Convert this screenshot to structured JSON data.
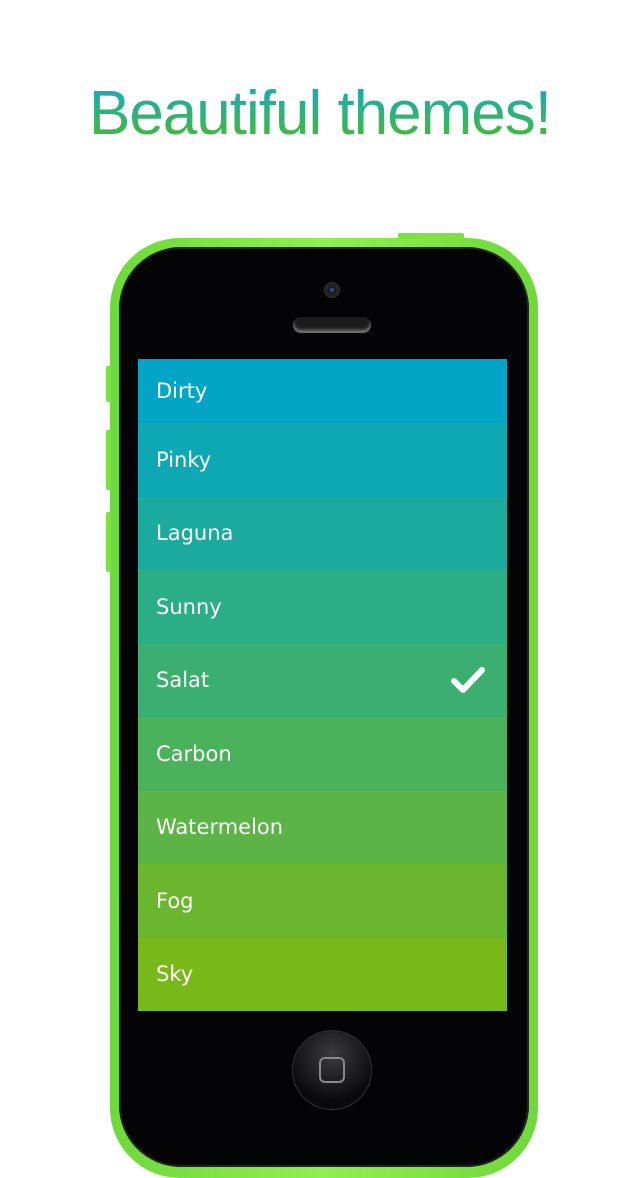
{
  "headline": "Beautiful themes!",
  "themes": [
    {
      "label": "Dirty",
      "color": "#03a5c6"
    },
    {
      "label": "Pinky",
      "color": "#0ea8b4"
    },
    {
      "label": "Laguna",
      "color": "#1aaa9e"
    },
    {
      "label": "Sunny",
      "color": "#2bad86"
    },
    {
      "label": "Salat",
      "color": "#3aaf70",
      "selected": true
    },
    {
      "label": "Carbon",
      "color": "#4ab25b"
    },
    {
      "label": "Watermelon",
      "color": "#5bb445"
    },
    {
      "label": "Fog",
      "color": "#6ab62f"
    },
    {
      "label": "Sky",
      "color": "#79b819"
    }
  ],
  "icons": {
    "selected": "checkmark-icon",
    "home": "home-button-icon"
  },
  "phone_color": "#7ee445"
}
